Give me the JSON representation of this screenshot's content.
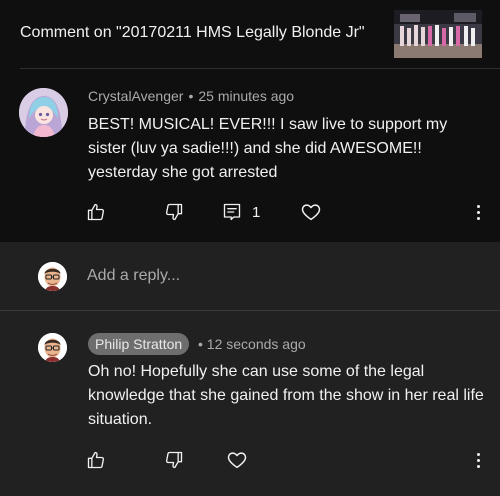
{
  "header": {
    "title": "Comment on \"20170211 HMS Legally Blonde Jr\""
  },
  "comment": {
    "author": "CrystalAvenger",
    "separator": "•",
    "time": "25 minutes ago",
    "text": "BEST! MUSICAL! EVER!!! I saw live to support my sister (luv ya sadie!!!) and she did AWESOME!! yesterday she got arrested",
    "reply_count": "1"
  },
  "reply_input": {
    "placeholder": "Add a reply..."
  },
  "reply": {
    "author": "Philip Stratton",
    "separator": "•",
    "time": "12 seconds ago",
    "text": "Oh no! Hopefully she can use some of the legal knowledge that she gained from the show in her real life situation."
  },
  "colors": {
    "background": "#0f0f0f",
    "reply_background": "#212121",
    "chip": "#6e6e6e",
    "secondary_text": "#aaaaaa"
  }
}
